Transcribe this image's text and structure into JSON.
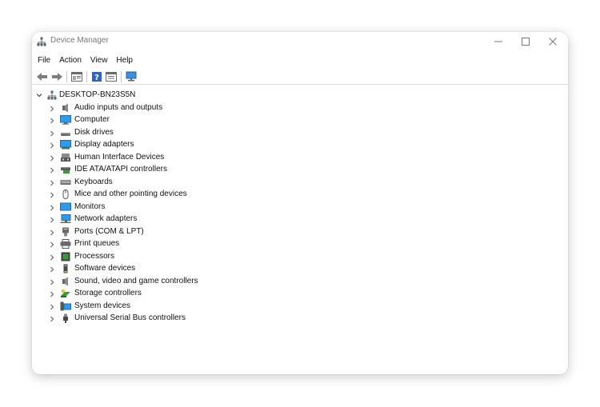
{
  "window": {
    "title": "Device Manager"
  },
  "menu": {
    "items": [
      "File",
      "Action",
      "View",
      "Help"
    ]
  },
  "tree": {
    "root": {
      "label": "DESKTOP-BN23S5N",
      "icon": "computer-tree-icon"
    },
    "nodes": [
      {
        "label": "Audio inputs and outputs",
        "icon": "speaker-icon"
      },
      {
        "label": "Computer",
        "icon": "monitor-icon"
      },
      {
        "label": "Disk drives",
        "icon": "disk-drive-icon"
      },
      {
        "label": "Display adapters",
        "icon": "display-adapter-icon"
      },
      {
        "label": "Human Interface Devices",
        "icon": "hid-icon"
      },
      {
        "label": "IDE ATA/ATAPI controllers",
        "icon": "ide-controller-icon"
      },
      {
        "label": "Keyboards",
        "icon": "keyboard-icon"
      },
      {
        "label": "Mice and other pointing devices",
        "icon": "mouse-icon"
      },
      {
        "label": "Monitors",
        "icon": "monitor-icon"
      },
      {
        "label": "Network adapters",
        "icon": "network-adapter-icon"
      },
      {
        "label": "Ports (COM & LPT)",
        "icon": "port-icon"
      },
      {
        "label": "Print queues",
        "icon": "printer-icon"
      },
      {
        "label": "Processors",
        "icon": "processor-icon"
      },
      {
        "label": "Software devices",
        "icon": "software-device-icon"
      },
      {
        "label": "Sound, video and game controllers",
        "icon": "speaker-icon"
      },
      {
        "label": "Storage controllers",
        "icon": "storage-controller-icon"
      },
      {
        "label": "System devices",
        "icon": "system-device-icon"
      },
      {
        "label": "Universal Serial Bus controllers",
        "icon": "usb-icon"
      }
    ]
  },
  "colors": {
    "accent": "#1e88d8",
    "text": "#111111",
    "title_text": "#7a7a7a"
  }
}
